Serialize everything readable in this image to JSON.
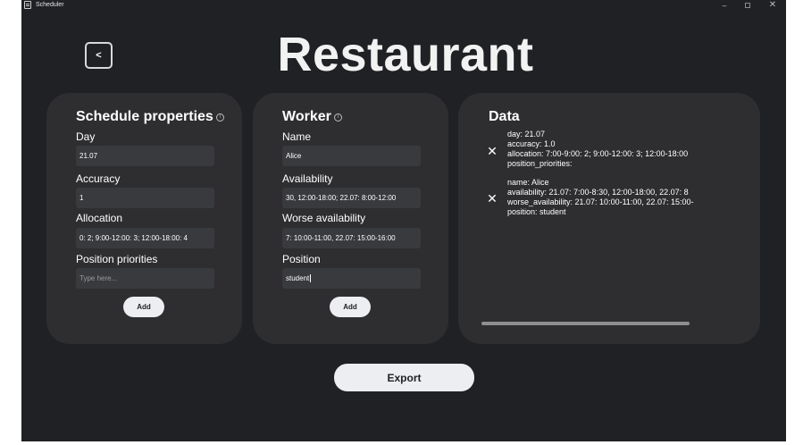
{
  "window": {
    "title": "Scheduler",
    "icon": "calendar-icon",
    "controls": {
      "minimize": "–",
      "maximize": "□",
      "close": "✕"
    }
  },
  "header": {
    "back_label": "<",
    "title": "Restaurant"
  },
  "schedule_properties": {
    "title": "Schedule properties",
    "info_icon": "ⓘ",
    "fields": [
      {
        "label": "Day",
        "value": "21.07",
        "placeholder": ""
      },
      {
        "label": "Accuracy",
        "value": "1",
        "placeholder": ""
      },
      {
        "label": "Allocation",
        "value": "0: 2; 9:00-12:00: 3; 12:00-18:00: 4",
        "placeholder": ""
      },
      {
        "label": "Position priorities",
        "value": "",
        "placeholder": "Type here..."
      }
    ],
    "add_label": "Add"
  },
  "worker": {
    "title": "Worker",
    "info_icon": "ⓘ",
    "fields": [
      {
        "label": "Name",
        "value": "Alice"
      },
      {
        "label": "Availability",
        "value": "30, 12:00-18:00; 22.07: 8:00-12:00"
      },
      {
        "label": "Worse availability",
        "value": "7: 10:00-11:00, 22.07: 15:00-16:00"
      },
      {
        "label": "Position",
        "value": "student"
      }
    ],
    "add_label": "Add"
  },
  "data_panel": {
    "title": "Data",
    "remove_icon": "✕",
    "entries": [
      {
        "lines": [
          "day: 21.07",
          "accuracy: 1.0",
          "allocation: 7:00-9:00: 2; 9:00-12:00: 3; 12:00-18:00",
          "position_priorities:"
        ]
      },
      {
        "lines": [
          "name: Alice",
          "availability: 21.07: 7:00-8:30, 12:00-18:00, 22.07: 8",
          "worse_availability: 21.07: 10:00-11:00, 22.07: 15:00-",
          "position: student"
        ]
      }
    ]
  },
  "footer": {
    "export_label": "Export"
  },
  "colors": {
    "background": "#202124",
    "card": "#2e2e31",
    "input": "#383a3e",
    "button": "#eceef2"
  }
}
